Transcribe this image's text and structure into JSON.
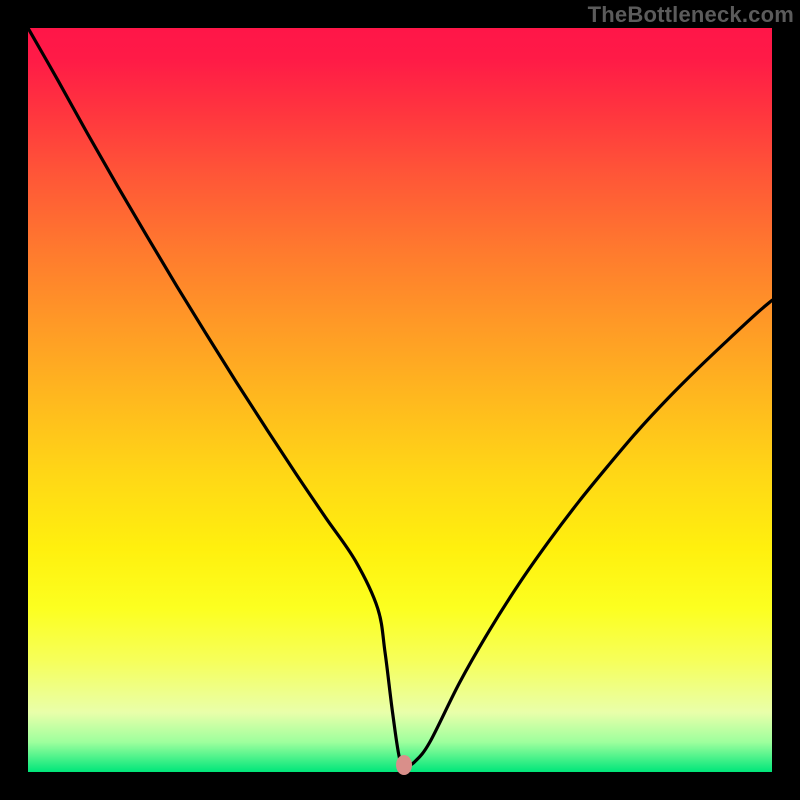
{
  "watermark": "TheBottleneck.com",
  "chart_data": {
    "type": "line",
    "title": "",
    "xlabel": "",
    "ylabel": "",
    "xlim": [
      0,
      100
    ],
    "ylim": [
      0,
      100
    ],
    "grid": false,
    "legend": false,
    "series": [
      {
        "name": "bottleneck-curve",
        "x": [
          0,
          4,
          8,
          12,
          16,
          20,
          24,
          28,
          32,
          36,
          40,
          44,
          47,
          48,
          49,
          50,
          51,
          52,
          54,
          58,
          62,
          66,
          70,
          74,
          78,
          82,
          86,
          90,
          94,
          98,
          100
        ],
        "y": [
          100,
          93,
          85.8,
          78.8,
          72,
          65.3,
          58.8,
          52.4,
          46.2,
          40.1,
          34.2,
          28.4,
          22,
          16,
          8,
          1.6,
          1,
          1.4,
          4,
          12,
          19,
          25.3,
          31,
          36.3,
          41.2,
          45.9,
          50.2,
          54.2,
          58,
          61.7,
          63.4
        ]
      }
    ],
    "marker": {
      "x": 50.5,
      "y": 1.0,
      "color": "#d98f8a"
    },
    "gradient_colors": {
      "top": "#ff1648",
      "mid_upper": "#ff9a26",
      "mid": "#fff00e",
      "mid_lower": "#e9ffaa",
      "bottom": "#00e67a"
    }
  }
}
